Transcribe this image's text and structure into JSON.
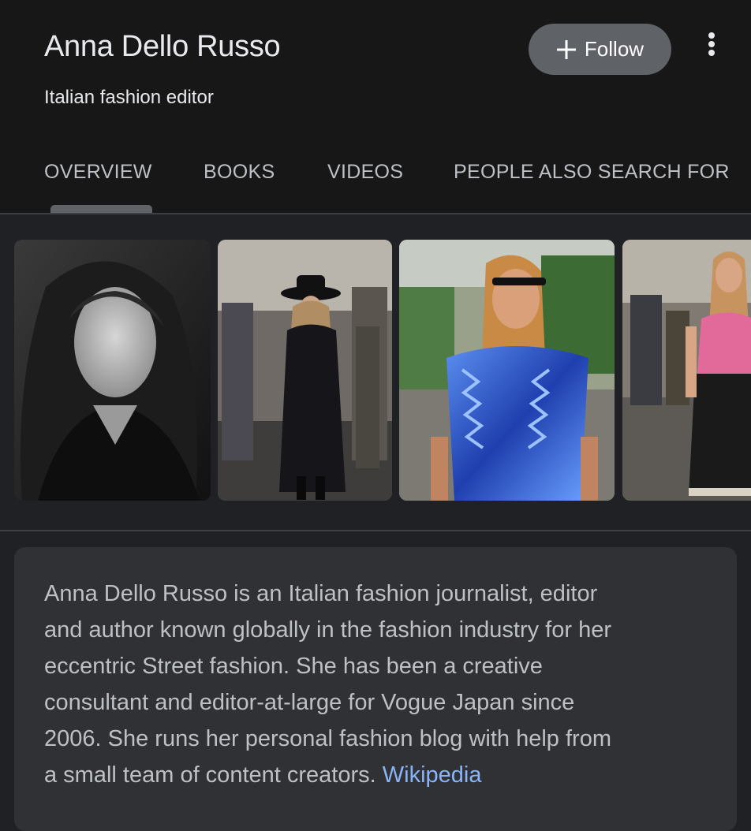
{
  "entity": {
    "name": "Anna Dello Russo",
    "subtitle": "Italian fashion editor"
  },
  "actions": {
    "follow_label": "Follow",
    "follow_icon": "plus-icon",
    "more_icon": "more-vert-icon"
  },
  "tabs": [
    {
      "label": "OVERVIEW",
      "selected": true
    },
    {
      "label": "BOOKS",
      "selected": false
    },
    {
      "label": "VIDEOS",
      "selected": false
    },
    {
      "label": "PEOPLE ALSO SEARCH FOR",
      "selected": false
    }
  ],
  "images": [
    {
      "name": "portrait-black-and-white"
    },
    {
      "name": "street-black-hat-coat"
    },
    {
      "name": "blue-metallic-ruffle-top"
    },
    {
      "name": "pink-top-street"
    }
  ],
  "description": {
    "lines": [
      "Anna Dello Russo is an Italian fashion journalist, editor",
      "and author known globally in the fashion industry for her",
      "eccentric Street fashion. She has been a creative",
      "consultant and editor-at-large for Vogue Japan since",
      "2006. She runs her personal fashion blog with help from",
      "a small team of content creators."
    ],
    "source_link": "Wikipedia"
  },
  "colors": {
    "background": "#202124",
    "header_background": "#171717",
    "button_background": "#5f6368",
    "card_background": "#303134",
    "link": "#8ab4f8",
    "text_secondary": "#bdc1c6"
  }
}
